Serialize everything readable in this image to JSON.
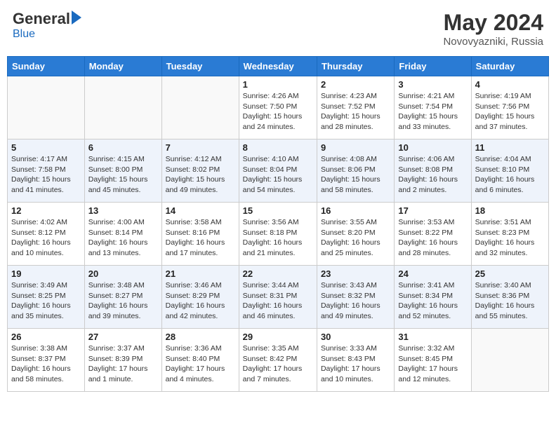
{
  "header": {
    "logo_general": "General",
    "logo_blue": "Blue",
    "month_year": "May 2024",
    "location": "Novovyazniki, Russia"
  },
  "days_of_week": [
    "Sunday",
    "Monday",
    "Tuesday",
    "Wednesday",
    "Thursday",
    "Friday",
    "Saturday"
  ],
  "weeks": [
    [
      {
        "day": "",
        "info": ""
      },
      {
        "day": "",
        "info": ""
      },
      {
        "day": "",
        "info": ""
      },
      {
        "day": "1",
        "info": "Sunrise: 4:26 AM\nSunset: 7:50 PM\nDaylight: 15 hours\nand 24 minutes."
      },
      {
        "day": "2",
        "info": "Sunrise: 4:23 AM\nSunset: 7:52 PM\nDaylight: 15 hours\nand 28 minutes."
      },
      {
        "day": "3",
        "info": "Sunrise: 4:21 AM\nSunset: 7:54 PM\nDaylight: 15 hours\nand 33 minutes."
      },
      {
        "day": "4",
        "info": "Sunrise: 4:19 AM\nSunset: 7:56 PM\nDaylight: 15 hours\nand 37 minutes."
      }
    ],
    [
      {
        "day": "5",
        "info": "Sunrise: 4:17 AM\nSunset: 7:58 PM\nDaylight: 15 hours\nand 41 minutes."
      },
      {
        "day": "6",
        "info": "Sunrise: 4:15 AM\nSunset: 8:00 PM\nDaylight: 15 hours\nand 45 minutes."
      },
      {
        "day": "7",
        "info": "Sunrise: 4:12 AM\nSunset: 8:02 PM\nDaylight: 15 hours\nand 49 minutes."
      },
      {
        "day": "8",
        "info": "Sunrise: 4:10 AM\nSunset: 8:04 PM\nDaylight: 15 hours\nand 54 minutes."
      },
      {
        "day": "9",
        "info": "Sunrise: 4:08 AM\nSunset: 8:06 PM\nDaylight: 15 hours\nand 58 minutes."
      },
      {
        "day": "10",
        "info": "Sunrise: 4:06 AM\nSunset: 8:08 PM\nDaylight: 16 hours\nand 2 minutes."
      },
      {
        "day": "11",
        "info": "Sunrise: 4:04 AM\nSunset: 8:10 PM\nDaylight: 16 hours\nand 6 minutes."
      }
    ],
    [
      {
        "day": "12",
        "info": "Sunrise: 4:02 AM\nSunset: 8:12 PM\nDaylight: 16 hours\nand 10 minutes."
      },
      {
        "day": "13",
        "info": "Sunrise: 4:00 AM\nSunset: 8:14 PM\nDaylight: 16 hours\nand 13 minutes."
      },
      {
        "day": "14",
        "info": "Sunrise: 3:58 AM\nSunset: 8:16 PM\nDaylight: 16 hours\nand 17 minutes."
      },
      {
        "day": "15",
        "info": "Sunrise: 3:56 AM\nSunset: 8:18 PM\nDaylight: 16 hours\nand 21 minutes."
      },
      {
        "day": "16",
        "info": "Sunrise: 3:55 AM\nSunset: 8:20 PM\nDaylight: 16 hours\nand 25 minutes."
      },
      {
        "day": "17",
        "info": "Sunrise: 3:53 AM\nSunset: 8:22 PM\nDaylight: 16 hours\nand 28 minutes."
      },
      {
        "day": "18",
        "info": "Sunrise: 3:51 AM\nSunset: 8:23 PM\nDaylight: 16 hours\nand 32 minutes."
      }
    ],
    [
      {
        "day": "19",
        "info": "Sunrise: 3:49 AM\nSunset: 8:25 PM\nDaylight: 16 hours\nand 35 minutes."
      },
      {
        "day": "20",
        "info": "Sunrise: 3:48 AM\nSunset: 8:27 PM\nDaylight: 16 hours\nand 39 minutes."
      },
      {
        "day": "21",
        "info": "Sunrise: 3:46 AM\nSunset: 8:29 PM\nDaylight: 16 hours\nand 42 minutes."
      },
      {
        "day": "22",
        "info": "Sunrise: 3:44 AM\nSunset: 8:31 PM\nDaylight: 16 hours\nand 46 minutes."
      },
      {
        "day": "23",
        "info": "Sunrise: 3:43 AM\nSunset: 8:32 PM\nDaylight: 16 hours\nand 49 minutes."
      },
      {
        "day": "24",
        "info": "Sunrise: 3:41 AM\nSunset: 8:34 PM\nDaylight: 16 hours\nand 52 minutes."
      },
      {
        "day": "25",
        "info": "Sunrise: 3:40 AM\nSunset: 8:36 PM\nDaylight: 16 hours\nand 55 minutes."
      }
    ],
    [
      {
        "day": "26",
        "info": "Sunrise: 3:38 AM\nSunset: 8:37 PM\nDaylight: 16 hours\nand 58 minutes."
      },
      {
        "day": "27",
        "info": "Sunrise: 3:37 AM\nSunset: 8:39 PM\nDaylight: 17 hours\nand 1 minute."
      },
      {
        "day": "28",
        "info": "Sunrise: 3:36 AM\nSunset: 8:40 PM\nDaylight: 17 hours\nand 4 minutes."
      },
      {
        "day": "29",
        "info": "Sunrise: 3:35 AM\nSunset: 8:42 PM\nDaylight: 17 hours\nand 7 minutes."
      },
      {
        "day": "30",
        "info": "Sunrise: 3:33 AM\nSunset: 8:43 PM\nDaylight: 17 hours\nand 10 minutes."
      },
      {
        "day": "31",
        "info": "Sunrise: 3:32 AM\nSunset: 8:45 PM\nDaylight: 17 hours\nand 12 minutes."
      },
      {
        "day": "",
        "info": ""
      }
    ]
  ]
}
